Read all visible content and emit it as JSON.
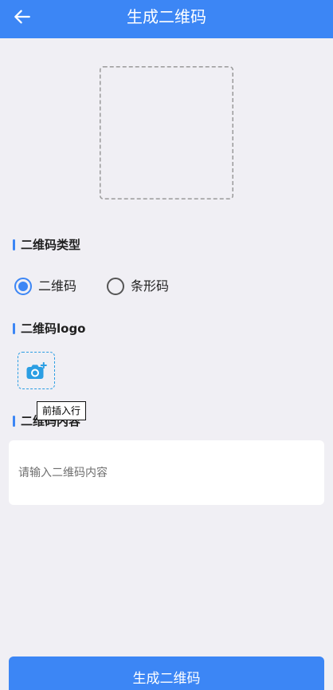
{
  "header": {
    "back_icon": "arrow-left-icon",
    "title": "生成二维码"
  },
  "qr_type": {
    "title": "二维码类型",
    "options": [
      {
        "label": "二维码",
        "selected": true
      },
      {
        "label": "条形码",
        "selected": false
      }
    ]
  },
  "logo": {
    "title": "二维码logo",
    "upload_icon": "camera-plus-icon"
  },
  "content": {
    "title": "二维码内容",
    "input_value": "",
    "input_placeholder": "请输入二维码内容"
  },
  "tooltip": {
    "text": "前插入行"
  },
  "submit": {
    "label": "生成二维码"
  },
  "colors": {
    "primary": "#3C86F5",
    "background": "#F0EFF4",
    "upload_accent": "#2B9EE3"
  }
}
